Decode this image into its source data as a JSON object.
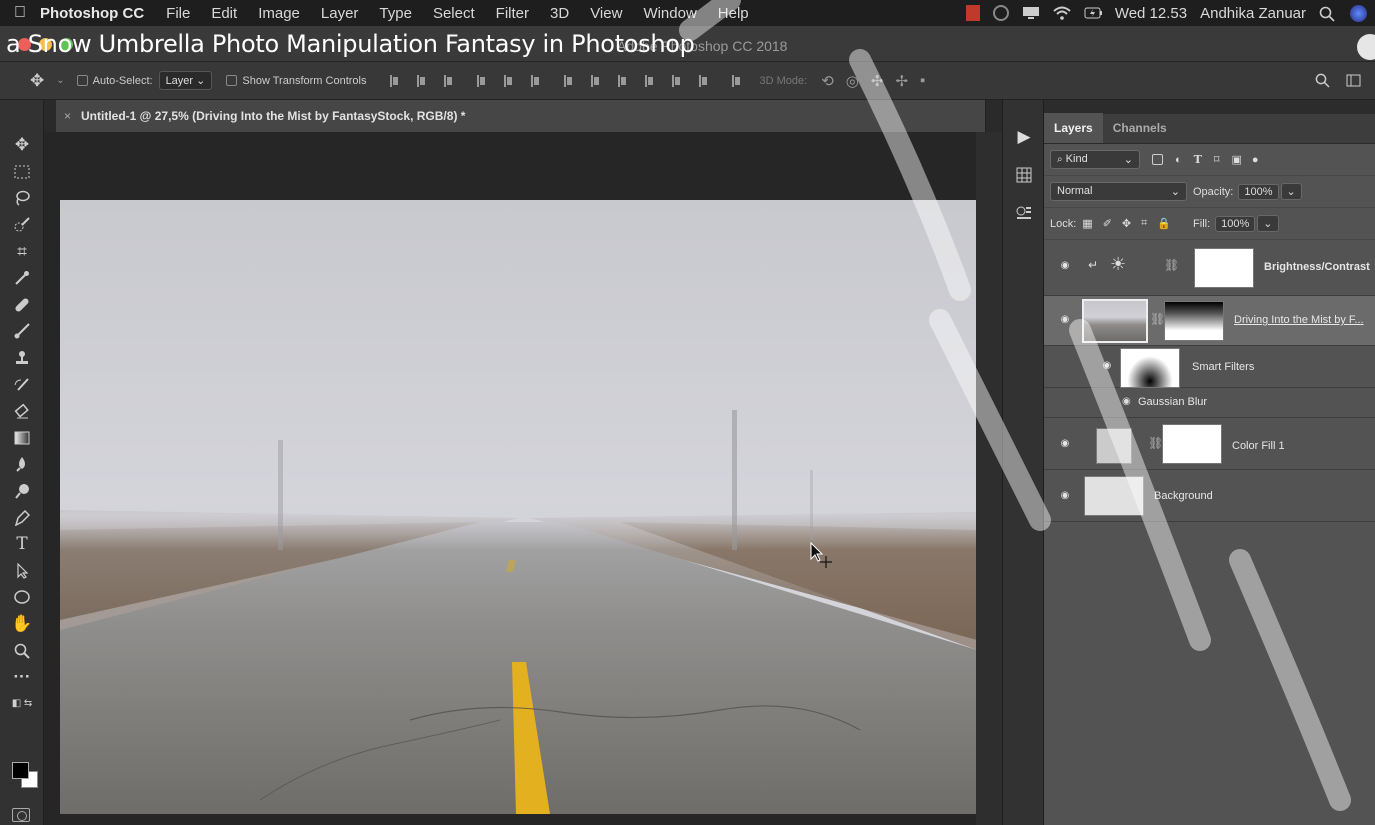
{
  "overlay_title": "a Snow Umbrella Photo Manipulation Fantasy in Photoshop",
  "menubar": {
    "app_name": "Photoshop CC",
    "items": [
      "File",
      "Edit",
      "Image",
      "Layer",
      "Type",
      "Select",
      "Filter",
      "3D",
      "View",
      "Window",
      "Help"
    ],
    "clock": "Wed 12.53",
    "user": "Andhika Zanuar"
  },
  "window": {
    "title": "Adobe Photoshop CC 2018"
  },
  "options_bar": {
    "auto_select_label": "Auto-Select:",
    "auto_select_value": "Layer",
    "show_transform_label": "Show Transform Controls",
    "mode_3d_label": "3D Mode:"
  },
  "document": {
    "tab_title": "Untitled-1 @ 27,5% (Driving Into the Mist by FantasyStock, RGB/8) *"
  },
  "layers_panel": {
    "tabs": [
      "Layers",
      "Channels"
    ],
    "filter_kind": "Kind",
    "blend_mode": "Normal",
    "opacity_label": "Opacity:",
    "opacity_value": "100%",
    "lock_label": "Lock:",
    "fill_label": "Fill:",
    "fill_value": "100%",
    "layers": [
      {
        "name": "Brightness/Contrast"
      },
      {
        "name": "Driving Into the Mist by F..."
      },
      {
        "name": "Smart Filters"
      },
      {
        "name": "Gaussian Blur"
      },
      {
        "name": "Color Fill 1"
      },
      {
        "name": "Background"
      }
    ]
  }
}
